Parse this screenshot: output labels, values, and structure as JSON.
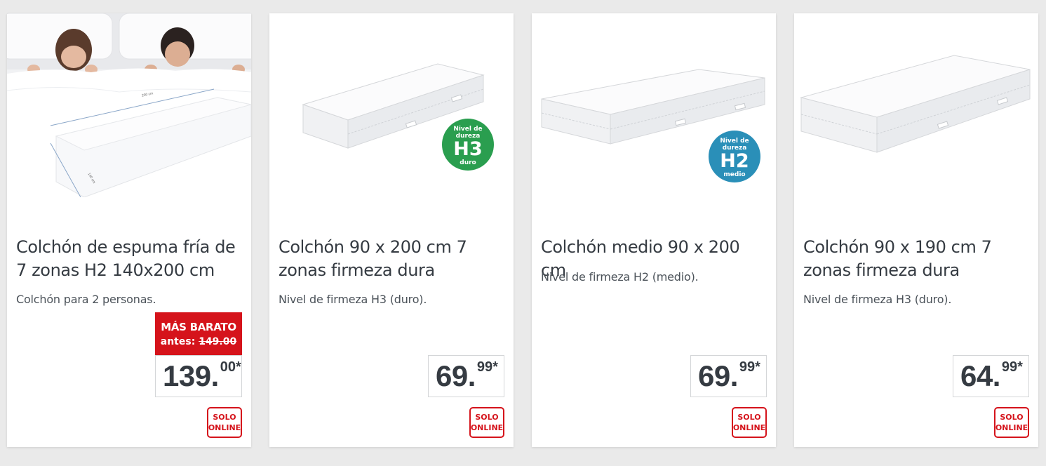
{
  "products": [
    {
      "title": "Colchón de espuma fría de 7 zonas H2 140x200 cm",
      "description": "Colchón para 2 personas.",
      "discount": {
        "label": "MÁS BARATO",
        "before_prefix": "antes:",
        "before_price": "149.00"
      },
      "price": {
        "main": "139.",
        "decimals": "00*"
      },
      "badge": {
        "line1": "SOLO",
        "line2": "ONLINE"
      },
      "image_labels": {
        "width": "200 cm",
        "depth": "140 cm"
      }
    },
    {
      "title": "Colchón 90 x 200 cm 7 zonas firmeza dura",
      "description": "Nivel de firmeza H3 (duro).",
      "hardness": {
        "top": "Nivel de dureza",
        "code": "H3",
        "bottom": "duro",
        "color": "#2a9e4f"
      },
      "price": {
        "main": "69.",
        "decimals": "99*"
      },
      "badge": {
        "line1": "SOLO",
        "line2": "ONLINE"
      }
    },
    {
      "title": "Colchón medio 90 x 200 cm",
      "description": "Nivel de firmeza H2 (medio).",
      "hardness": {
        "top": "Nivel de dureza",
        "code": "H2",
        "bottom": "medio",
        "color": "#2a8fb8"
      },
      "price": {
        "main": "69.",
        "decimals": "99*"
      },
      "badge": {
        "line1": "SOLO",
        "line2": "ONLINE"
      }
    },
    {
      "title": "Colchón 90 x 190 cm 7 zonas firmeza dura",
      "description": "Nivel de firmeza H3 (duro).",
      "price": {
        "main": "64.",
        "decimals": "99*"
      },
      "badge": {
        "line1": "SOLO",
        "line2": "ONLINE"
      }
    }
  ],
  "colors": {
    "accent_red": "#d5131b",
    "text_dark": "#353b42",
    "background": "#eaeaea",
    "h3_green": "#2a9e4f",
    "h2_blue": "#2a8fb8"
  }
}
